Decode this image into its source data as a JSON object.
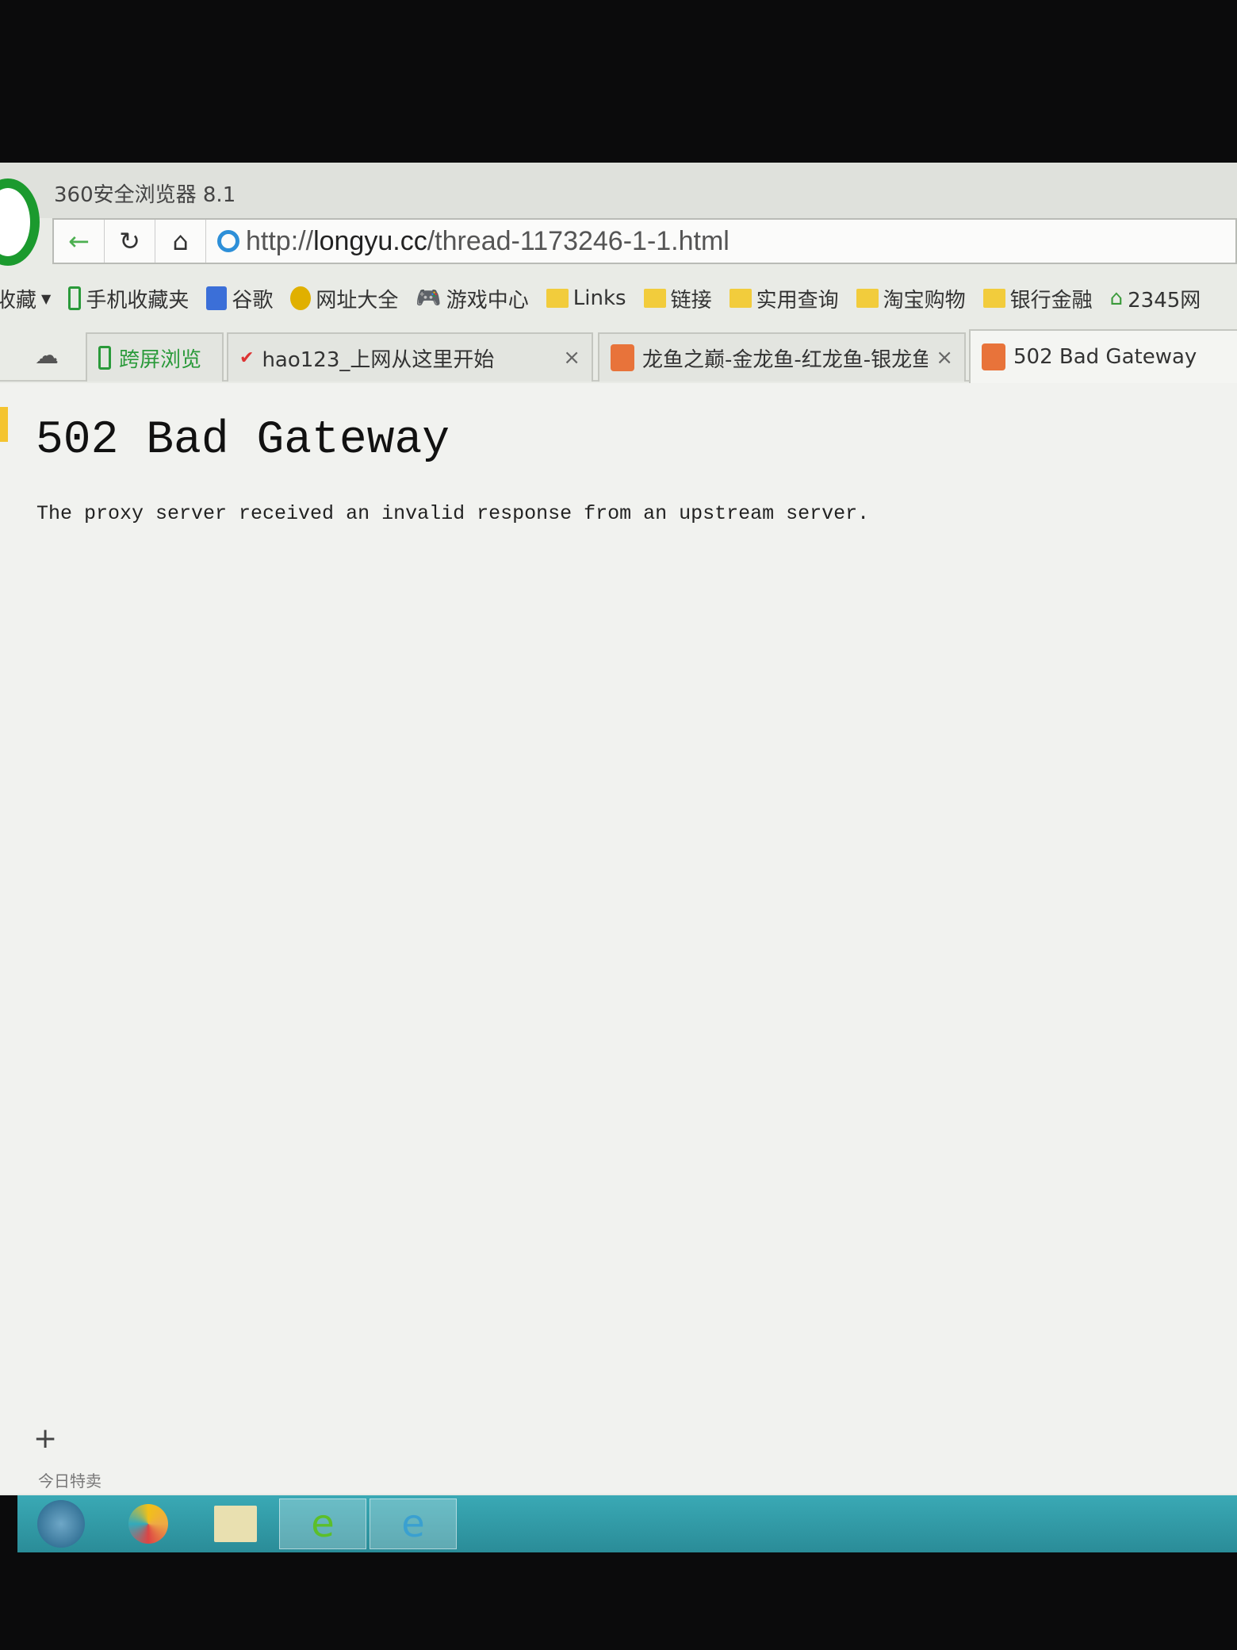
{
  "browser": {
    "title": "360安全浏览器 8.1",
    "url_prefix": "http://",
    "url_domain": "longyu.cc",
    "url_path": "/thread-1173246-1-1.html"
  },
  "nav": {
    "back": "←",
    "reload": "↻",
    "home": "⌂"
  },
  "bookmarks": [
    {
      "label": "收藏",
      "icon": "star-dropdown"
    },
    {
      "label": "手机收藏夹",
      "icon": "phone-icon"
    },
    {
      "label": "谷歌",
      "icon": "google-icon"
    },
    {
      "label": "网址大全",
      "icon": "plus-circle-icon"
    },
    {
      "label": "游戏中心",
      "icon": "gamepad-icon"
    },
    {
      "label": "Links",
      "icon": "folder-icon"
    },
    {
      "label": "链接",
      "icon": "folder-icon"
    },
    {
      "label": "实用查询",
      "icon": "folder-icon"
    },
    {
      "label": "淘宝购物",
      "icon": "folder-icon"
    },
    {
      "label": "银行金融",
      "icon": "folder-icon"
    },
    {
      "label": "2345网",
      "icon": "house-icon"
    }
  ],
  "tabs": [
    {
      "label": "跨屏浏览"
    },
    {
      "label": "hao123_上网从这里开始",
      "close": "×"
    },
    {
      "label": "龙鱼之巅-金龙鱼-红龙鱼-银龙鱼",
      "close": "×"
    },
    {
      "label": "502 Bad Gateway"
    }
  ],
  "page": {
    "heading": "502 Bad Gateway",
    "message": "The proxy server received an invalid response from an upstream server."
  },
  "sidebar": {
    "add": "+",
    "deal": "今日特卖"
  },
  "colors": {
    "brand": "#1b9a2e",
    "taskbar": "#2a8c98"
  }
}
